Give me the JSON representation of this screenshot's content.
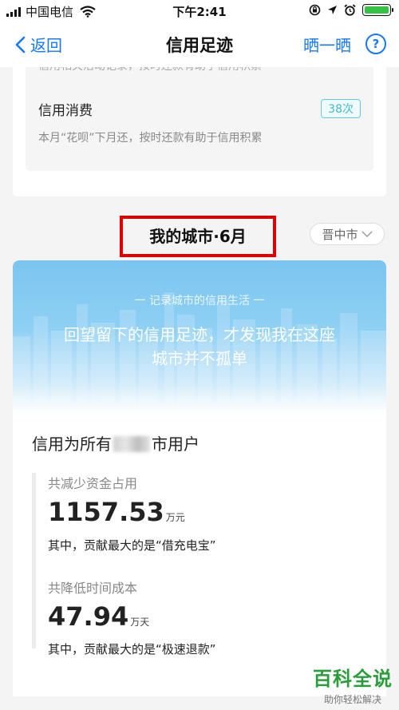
{
  "status_bar": {
    "carrier": "中国电信",
    "time": "下午2:41",
    "battery_level": 1.0
  },
  "nav": {
    "back_label": "返回",
    "title": "信用足迹",
    "share_label": "晒一晒",
    "help_label": "?"
  },
  "credit_card": {
    "cut_text": "信用相关活动记录，按时还款有助于信用积累",
    "title": "信用消费",
    "badge": "38次",
    "desc": "本月“花呗”下月还，按时还款有助于信用积累"
  },
  "city_section": {
    "title": "我的城市·6月",
    "city_select": "晋中市"
  },
  "city_card": {
    "banner_sub": "一 记录城市的信用生活 一",
    "banner_main": "回望留下的信用足迹，才发现我在这座城市并不孤单",
    "user_title_prefix": "信用为所有",
    "user_title_suffix": "市用户",
    "stats": [
      {
        "label": "共减少资金占用",
        "value": "1157.53",
        "unit": "万元",
        "note": "其中，贡献最大的是“借充电宝”"
      },
      {
        "label": "共降低时间成本",
        "value": "47.94",
        "unit": "万天",
        "note": "其中，贡献最大的是“极速退款”"
      }
    ]
  },
  "watermark": {
    "main": "百科全说",
    "sub": "助你轻松解决"
  }
}
